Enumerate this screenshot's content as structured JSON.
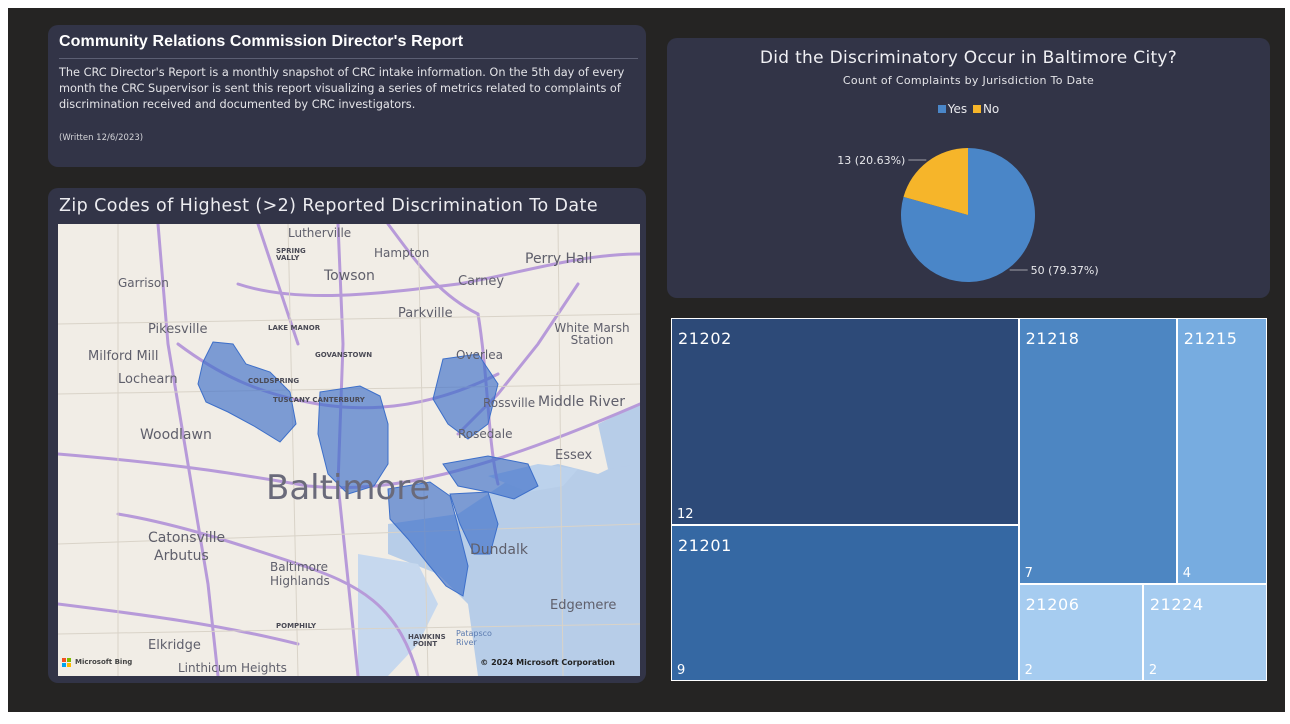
{
  "header": {
    "title": "Community Relations Commission Director's Report",
    "description": "The CRC Director's Report is a monthly snapshot of CRC intake information. On the 5th day of every month the CRC Supervisor is sent this report visualizing a series of metrics related to complaints of discrimination received and documented by CRC investigators.",
    "note": "(Written 12/6/2023)"
  },
  "map": {
    "title": "Zip Codes of Highest (>2) Reported Discrimination To Date",
    "brand": "Microsoft Bing",
    "copyright": "© 2024 Microsoft Corporation",
    "places": [
      "Lutherville",
      "Hampton",
      "Perry Hall",
      "Garrison",
      "Towson",
      "Carney",
      "Parkville",
      "White Marsh Station",
      "Pikesville",
      "LAKE MANOR",
      "Milford Mill",
      "GOVANSTOWN",
      "Overlea",
      "Lochearn",
      "COLDSPRING",
      "TUSCANY CANTERBURY",
      "Rossville",
      "Middle River",
      "Woodlawn",
      "Rosedale",
      "Essex",
      "Baltimore",
      "Catonsville",
      "Arbutus",
      "Baltimore Highlands",
      "Dundalk",
      "Edgemere",
      "Elkridge",
      "Linthicum Heights",
      "SPRING VALLY",
      "POMPHILY",
      "HAWKINS POINT",
      "Patapsco River"
    ],
    "colors": {
      "highlight": "#3d6fc9",
      "water": "#b7cde8",
      "road": "#b79ad9",
      "land": "#f1ede6"
    }
  },
  "pie": {
    "title": "Did the Discriminatory Occur in Baltimore City?",
    "subtitle": "Count of Complaints by Jurisdiction To Date",
    "legend": [
      "Yes",
      "No"
    ]
  },
  "treemap": {
    "tiles": [
      {
        "zip": "21202",
        "value": "12",
        "color": "#2d4a78"
      },
      {
        "zip": "21201",
        "value": "9",
        "color": "#3568a3"
      },
      {
        "zip": "21218",
        "value": "7",
        "color": "#4d86c2"
      },
      {
        "zip": "21215",
        "value": "4",
        "color": "#77ace0"
      },
      {
        "zip": "21206",
        "value": "2",
        "color": "#a6ccf0"
      },
      {
        "zip": "21224",
        "value": "2",
        "color": "#a6ccf0"
      }
    ]
  },
  "chart_data": [
    {
      "type": "pie",
      "title": "Did the Discriminatory Occur in Baltimore City?",
      "subtitle": "Count of Complaints by Jurisdiction To Date",
      "legend_position": "top-center",
      "slices": [
        {
          "label": "Yes",
          "value": 50,
          "percent": 79.37,
          "data_label": "50 (79.37%)",
          "color": "#4a86c8"
        },
        {
          "label": "No",
          "value": 13,
          "percent": 20.63,
          "data_label": "13 (20.63%)",
          "color": "#f6b52a"
        }
      ]
    },
    {
      "type": "treemap",
      "categories": [
        "21202",
        "21201",
        "21218",
        "21215",
        "21206",
        "21224"
      ],
      "values": [
        12,
        9,
        7,
        4,
        2,
        2
      ]
    }
  ]
}
